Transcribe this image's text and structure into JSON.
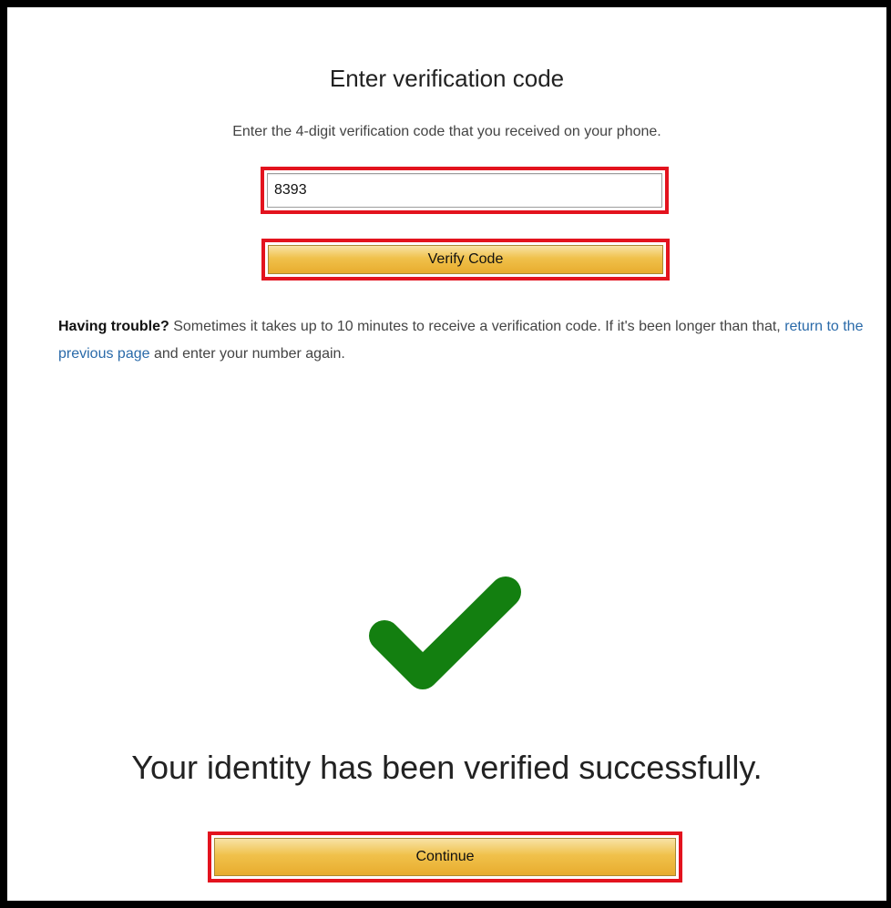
{
  "page": {
    "title": "Enter verification code",
    "instruction": "Enter the 4-digit verification code that you received on your phone.",
    "code_input": {
      "value": "8393",
      "placeholder": ""
    },
    "verify_button_label": "Verify Code",
    "trouble": {
      "bold": "Having trouble?",
      "text_before_link": " Sometimes it takes up to 10 minutes to receive a verification code. If it's been longer than that, ",
      "link": "return to the previous page",
      "text_after_link": " and enter your number again."
    },
    "success_icon": "checkmark-icon",
    "success_message": "Your identity has been verified successfully.",
    "continue_button_label": "Continue"
  },
  "colors": {
    "highlight": "#e3131e",
    "button": "#f0c14b",
    "link": "#2a6aa9",
    "checkmark": "#137f10"
  }
}
